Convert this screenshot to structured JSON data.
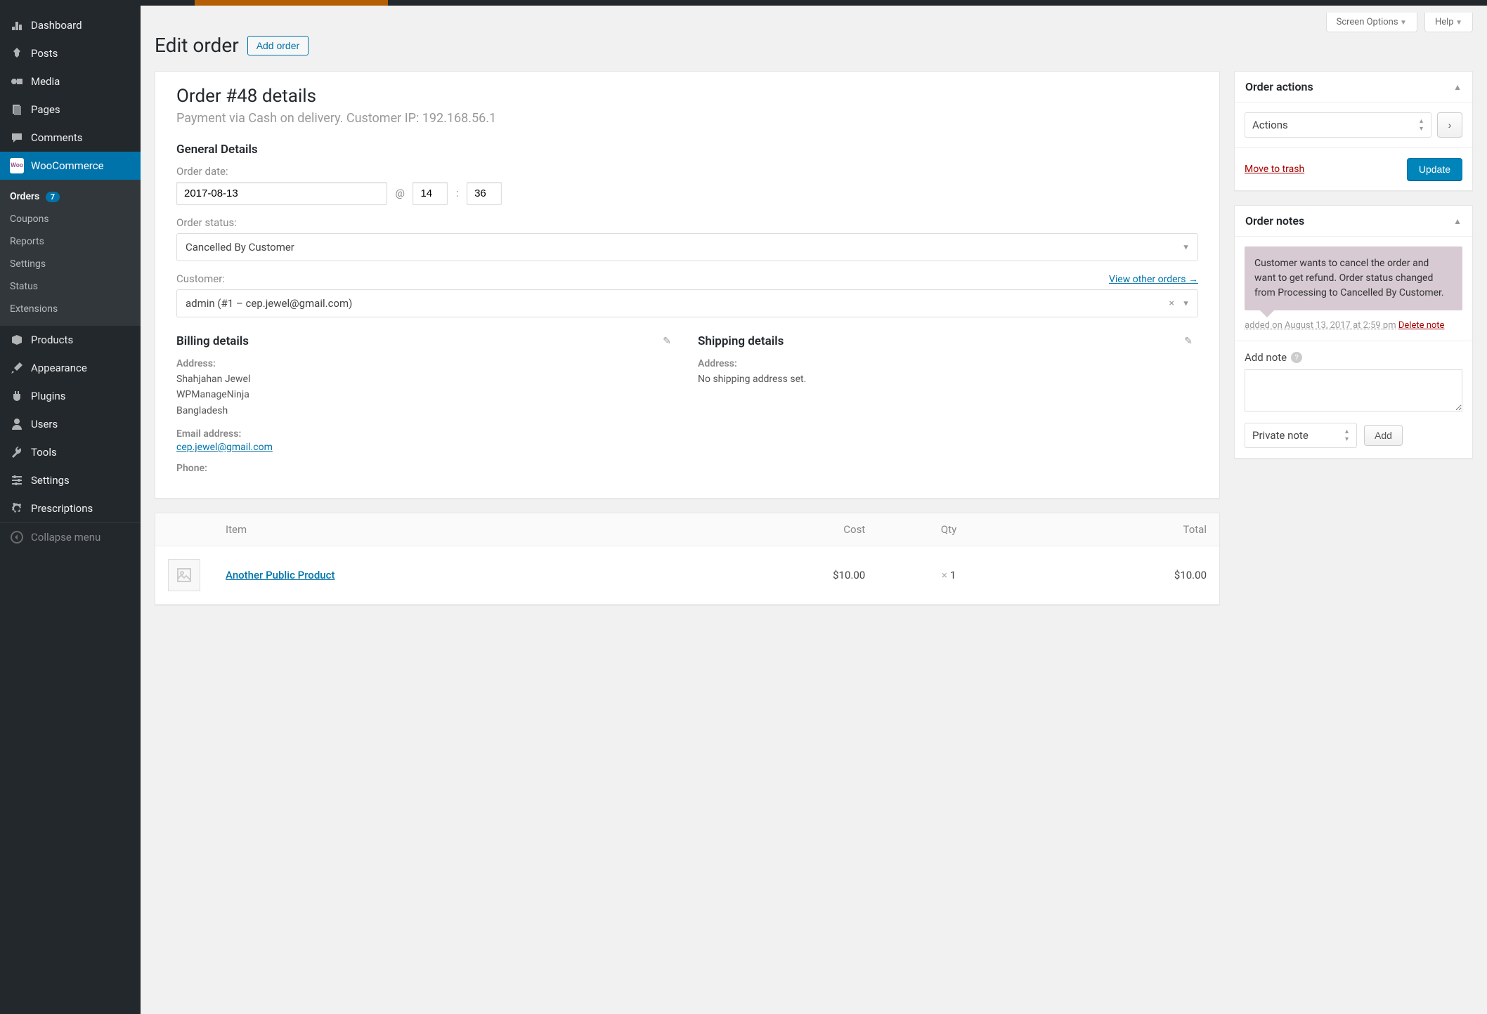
{
  "sidebar": {
    "items": [
      {
        "label": "Dashboard",
        "icon": "dashboard"
      },
      {
        "label": "Posts",
        "icon": "pin"
      },
      {
        "label": "Media",
        "icon": "media"
      },
      {
        "label": "Pages",
        "icon": "page"
      },
      {
        "label": "Comments",
        "icon": "comment"
      },
      {
        "label": "WooCommerce",
        "icon": "woo",
        "active": true
      },
      {
        "label": "Products",
        "icon": "box"
      },
      {
        "label": "Appearance",
        "icon": "brush"
      },
      {
        "label": "Plugins",
        "icon": "plug"
      },
      {
        "label": "Users",
        "icon": "user"
      },
      {
        "label": "Tools",
        "icon": "wrench"
      },
      {
        "label": "Settings",
        "icon": "sliders"
      },
      {
        "label": "Prescriptions",
        "icon": "gear"
      }
    ],
    "submenu": [
      {
        "label": "Orders",
        "badge": "7",
        "current": true
      },
      {
        "label": "Coupons"
      },
      {
        "label": "Reports"
      },
      {
        "label": "Settings"
      },
      {
        "label": "Status"
      },
      {
        "label": "Extensions"
      }
    ],
    "collapse": "Collapse menu"
  },
  "screen_meta": {
    "options": "Screen Options",
    "help": "Help"
  },
  "page": {
    "title": "Edit order",
    "add": "Add order"
  },
  "order": {
    "heading": "Order #48 details",
    "sub": "Payment via Cash on delivery. Customer IP: 192.168.56.1",
    "general_h": "General Details",
    "date_label": "Order date:",
    "date": "2017-08-13",
    "hour": "14",
    "minute": "36",
    "status_label": "Order status:",
    "status": "Cancelled By Customer",
    "customer_label": "Customer:",
    "view_other": "View other orders →",
    "customer": "admin (#1 – cep.jewel@gmail.com)"
  },
  "billing": {
    "h": "Billing details",
    "addr_label": "Address:",
    "addr1": "Shahjahan Jewel",
    "addr2": "WPManageNinja",
    "addr3": "Bangladesh",
    "email_label": "Email address:",
    "email": "cep.jewel@gmail.com",
    "phone_label": "Phone:"
  },
  "shipping": {
    "h": "Shipping details",
    "addr_label": "Address:",
    "none": "No shipping address set."
  },
  "actions_box": {
    "h": "Order actions",
    "select": "Actions",
    "trash": "Move to trash",
    "update": "Update"
  },
  "notes_box": {
    "h": "Order notes",
    "note": "Customer wants to cancel the order and want to get refund. Order status changed from Processing to Cancelled By Customer.",
    "ts": "added on August 13, 2017 at 2:59 pm",
    "delete": "Delete note",
    "add_label": "Add note",
    "type": "Private note",
    "add_btn": "Add"
  },
  "items": {
    "cols": {
      "item": "Item",
      "cost": "Cost",
      "qty": "Qty",
      "total": "Total"
    },
    "rows": [
      {
        "name": "Another Public Product",
        "cost": "$10.00",
        "qty": "1",
        "total": "$10.00"
      }
    ]
  }
}
